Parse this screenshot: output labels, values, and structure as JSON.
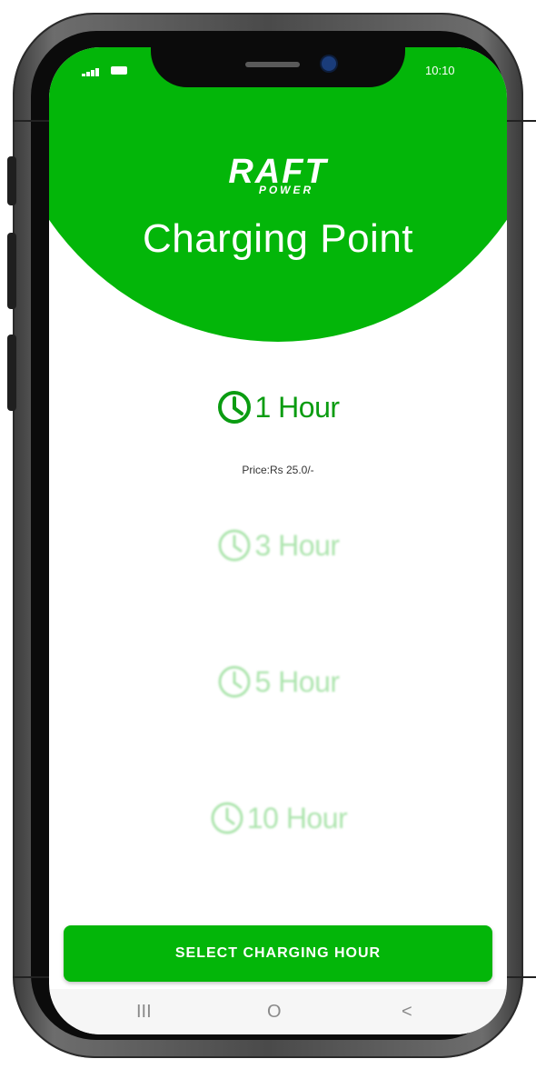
{
  "status_bar": {
    "time": "10:10"
  },
  "brand": {
    "logo_main": "RAFT",
    "logo_sub": "POWER"
  },
  "page_title": "Charging Point",
  "options": [
    {
      "label": "1 Hour",
      "selected": true,
      "price_text": "Price:Rs 25.0/-"
    },
    {
      "label": "3 Hour",
      "selected": false
    },
    {
      "label": "5 Hour",
      "selected": false
    },
    {
      "label": "10 Hour",
      "selected": false
    }
  ],
  "select_button_label": "SELECT CHARGING HOUR",
  "navbar": {
    "recents": "III",
    "home": "O",
    "back": "<"
  },
  "colors": {
    "accent": "#03b609",
    "accent_dark": "#0a9c11",
    "accent_faded": "#9fe0a0",
    "bolt": "#c6f21e"
  },
  "icons": [
    "clock-icon",
    "signal-icon",
    "battery-icon"
  ]
}
